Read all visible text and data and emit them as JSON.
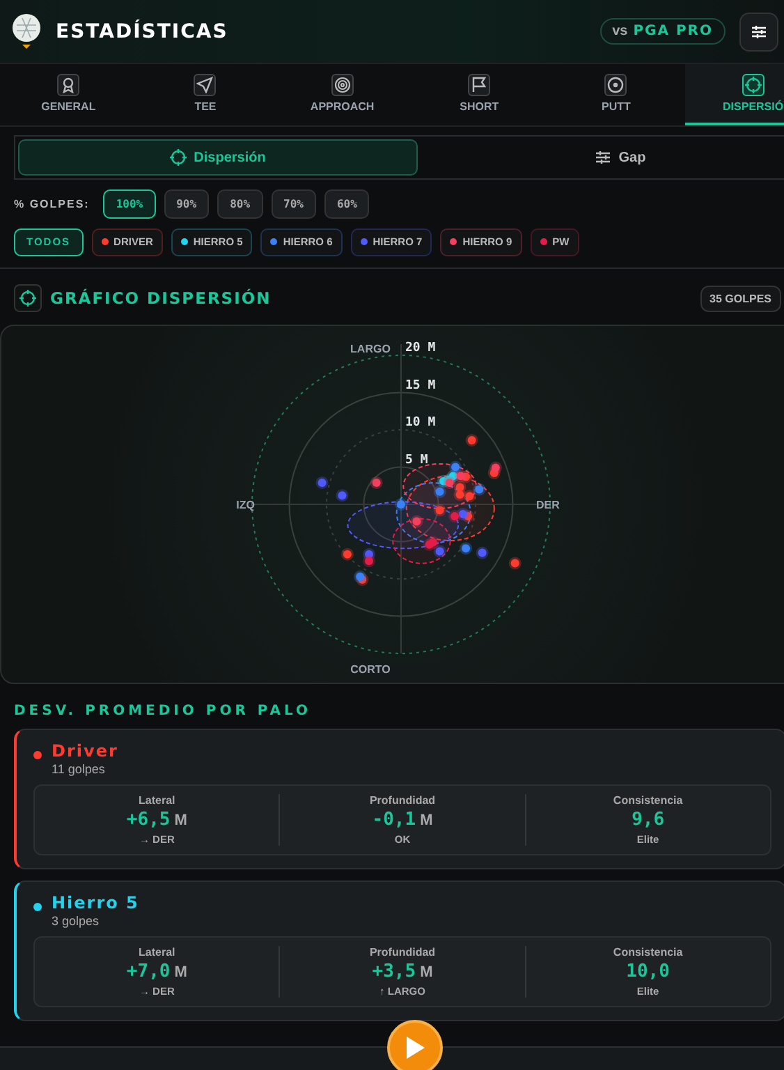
{
  "header": {
    "title": "ESTADÍSTICAS",
    "compare_prefix": "vs",
    "compare_target": "PGA PRO"
  },
  "tabs": [
    {
      "label": "GENERAL",
      "selected": false
    },
    {
      "label": "TEE",
      "selected": false
    },
    {
      "label": "APPROACH",
      "selected": false
    },
    {
      "label": "SHORT",
      "selected": false
    },
    {
      "label": "PUTT",
      "selected": false
    },
    {
      "label": "DISPERSIÓ",
      "selected": true
    }
  ],
  "view_switch": [
    {
      "label": "Dispersión",
      "selected": true
    },
    {
      "label": "Gap",
      "selected": false
    }
  ],
  "shot_filter": {
    "label": "% GOLPES:",
    "options": [
      {
        "label": "100%",
        "selected": true
      },
      {
        "label": "90%",
        "selected": false
      },
      {
        "label": "80%",
        "selected": false
      },
      {
        "label": "70%",
        "selected": false
      },
      {
        "label": "60%",
        "selected": false
      }
    ]
  },
  "club_filter": [
    {
      "label": "TODOS",
      "selected": true
    },
    {
      "label": "DRIVER",
      "color": "#ff3b30",
      "selected": false
    },
    {
      "label": "HIERRO 5",
      "color": "#22d3ee",
      "selected": false
    },
    {
      "label": "HIERRO 6",
      "color": "#3b82f6",
      "selected": false
    },
    {
      "label": "HIERRO 7",
      "color": "#4f5bff",
      "selected": false
    },
    {
      "label": "HIERRO 9",
      "color": "#f43f5e",
      "selected": false
    },
    {
      "label": "PW",
      "color": "#e11d48",
      "selected": false
    }
  ],
  "dispersion": {
    "title": "GRÁFICO DISPERSIÓN",
    "count": "35 GOLPES",
    "directions": {
      "top": "LARGO",
      "bottom": "CORTO",
      "left": "IZQ",
      "right": "DER"
    },
    "ring_labels": [
      "20 M",
      "15 M",
      "10 M",
      "5 M"
    ]
  },
  "averages": {
    "title": "DESV. PROMEDIO POR PALO",
    "clubs": [
      {
        "name": "Driver",
        "color": "#ff3b30",
        "shots": "11 golpes",
        "stats": [
          {
            "label": "Lateral",
            "value": "+6,5",
            "unit": "M",
            "note": "→ DER"
          },
          {
            "label": "Profundidad",
            "value": "-0,1",
            "unit": "M",
            "note": "OK"
          },
          {
            "label": "Consistencia",
            "value": "9,6",
            "note": "Elite"
          }
        ]
      },
      {
        "name": "Hierro 5",
        "color": "#22d3ee",
        "shots": "3 golpes",
        "stats": [
          {
            "label": "Lateral",
            "value": "+7,0",
            "unit": "M",
            "note": "→ DER"
          },
          {
            "label": "Profundidad",
            "value": "+3,5",
            "unit": "M",
            "note": "↑ LARGO"
          },
          {
            "label": "Consistencia",
            "value": "10,0",
            "note": "Elite"
          }
        ]
      }
    ]
  }
}
